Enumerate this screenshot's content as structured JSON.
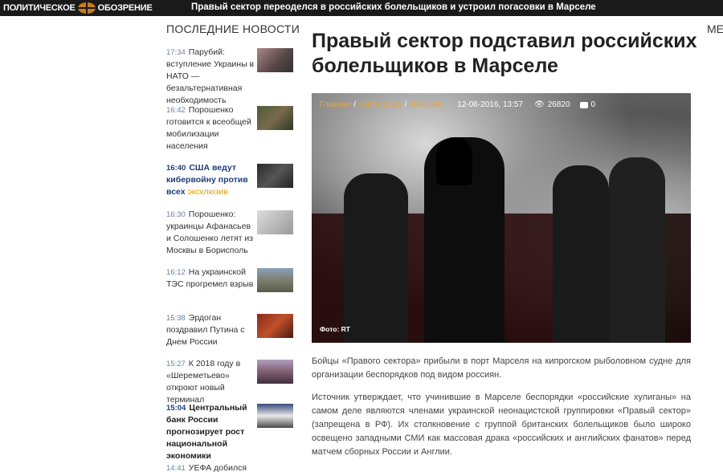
{
  "header": {
    "logo_word1": "ПОЛИТИЧЕСКОЕ",
    "logo_word2": "ОБОЗРЕНИЕ",
    "ticker": "Правый сектор переоделся в российских болельщиков и устроил погасовки в Марселе"
  },
  "sidebar": {
    "title": "ПОСЛЕДНИЕ НОВОСТИ",
    "items": [
      {
        "time": "17:34",
        "text": "Парубий: вступление Украины в НАТО — безальтернативная необходимость",
        "style": "normal",
        "tag": ""
      },
      {
        "time": "16:42",
        "text": "Порошенко готовится к всеобщей мобилизации населения",
        "style": "normal",
        "tag": ""
      },
      {
        "time": "16:40",
        "text": "США ведут кибервойну против всех",
        "style": "bold",
        "tag": "эксклюзив"
      },
      {
        "time": "16:30",
        "text": "Порошенко: украинцы Афанасьев и Солошенко летят из Москвы в Борисполь",
        "style": "normal",
        "tag": ""
      },
      {
        "time": "16:12",
        "text": "На украинской ТЭС прогремел взрыв",
        "style": "normal",
        "tag": ""
      },
      {
        "time": "15:38",
        "text": "Эрдоган поздравил Путина с Днем России",
        "style": "normal",
        "tag": ""
      },
      {
        "time": "15:27",
        "text": "К 2018 году в «Шереметьево» откроют новый терминал",
        "style": "normal",
        "tag": ""
      },
      {
        "time": "15:04",
        "text": "Центральный банк России прогнозирует рост национальной экономики",
        "style": "dark",
        "tag": ""
      },
      {
        "time": "14:41",
        "text": "УЕФА добился",
        "style": "normal",
        "tag": ""
      }
    ]
  },
  "right_column_cut": "МЕ",
  "article": {
    "headline": "Правый сектор подставил российских болельщиков в Марселе",
    "breadcrumb_home": "Главное",
    "breadcrumb_sep": "/",
    "breadcrumb_cat": "ЕВРО 2016",
    "breadcrumb_src": "ИноСМИ",
    "date": "12-06-2016, 13:57",
    "views": "26820",
    "comments": "0",
    "photo_credit": "Фото: RT",
    "paragraphs": [
      "Бойцы «Правого сектора» прибыли в порт Марселя на кипрогском рыболовном судне для организации беспорядков под видом россиян.",
      "Источник утверждает, что учинившие в Марселе беспорядки «российские хулиганы» на самом деле являются членами украинской неонацистской группировки «Правый сектор» (запрещена в РФ). Их столкновение с группой британских болельщиков было широко освещено западными СМИ как массовая драка «российских и английских фанатов» перед матчем сборных России и Англии."
    ]
  },
  "icons": [
    "globe-logo-icon",
    "eye-icon",
    "comment-icon"
  ],
  "colors": {
    "topbar": "#1a1a1a",
    "link_orange": "#e6a53a",
    "headline_blue": "#1d3f7a",
    "tag_yellow": "#e0a000"
  }
}
